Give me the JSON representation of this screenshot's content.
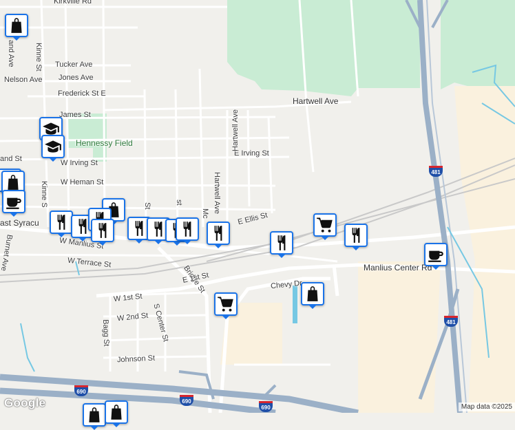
{
  "streets": {
    "kirkville_rd": "Kirkville Rd",
    "tucker_ave": "Tucker Ave",
    "jones_ave": "Jones Ave",
    "nelson_ave": "Nelson Ave",
    "frederick_st": "Frederick St E",
    "hartwell_ave_top": "Hartwell Ave",
    "james_st": "James St",
    "hartwell_ave_v1": "Hartwell Ave",
    "hartwell_ave_v2": "Hartwell Ave",
    "e_irving_st": "E Irving St",
    "w_irving_st": "W Irving St",
    "and_st": "and St",
    "w_heman_st": "W Heman St",
    "e_ellis_st": "E Ellis St",
    "kinne_st_top": "Kinne St",
    "kinne_st_mid": "Kinne S",
    "and_ave": "and Ave",
    "w_manlius_st": "W Manlius St",
    "w_terrace_st": "W Terrace St",
    "bridge_st": "Bridge St",
    "e_1st_st": "E 1st St",
    "manlius_center_rd": "Manlius Center Rd",
    "chevy_dr": "Chevy Dr",
    "w_1st_st": "W 1st St",
    "w_2nd_st": "W 2nd St",
    "s_center_st": "S Center St",
    "bagg_st": "Bagg St",
    "johnson_st": "Johnson St",
    "burnet_ave": "Burnet Ave",
    "east_syracuse": "ast Syracu",
    "st_label1": "St",
    "st_label2": "st",
    "mc_label": "Mc"
  },
  "places": {
    "hennessy_field": "Hennessy Field"
  },
  "shields": {
    "i481_a": "481",
    "i481_b": "481",
    "i690_a": "690",
    "i690_b": "690",
    "i690_c": "690"
  },
  "attribution": {
    "logo": "Google",
    "credit": "Map data ©2025"
  },
  "colors": {
    "background": "#f1f0ec",
    "park": "#c9ecd4",
    "industrial": "#faf1de",
    "highway": "#9bb0c7",
    "water": "#76c8e3",
    "pin_border": "#1a73e8"
  },
  "pins": [
    {
      "type": "shopping-bag-icon"
    },
    {
      "type": "school-icon"
    },
    {
      "type": "school-icon"
    },
    {
      "type": "shopping-bag-icon"
    },
    {
      "type": "shopping-bag-icon"
    },
    {
      "type": "coffee-icon"
    },
    {
      "type": "restaurant-icon"
    },
    {
      "type": "restaurant-icon"
    },
    {
      "type": "shopping-bag-icon"
    },
    {
      "type": "restaurant-icon"
    },
    {
      "type": "restaurant-icon"
    },
    {
      "type": "restaurant-icon"
    },
    {
      "type": "restaurant-icon"
    },
    {
      "type": "restaurant-icon"
    },
    {
      "type": "restaurant-icon"
    },
    {
      "type": "restaurant-icon"
    },
    {
      "type": "shopping-cart-icon"
    },
    {
      "type": "restaurant-icon"
    },
    {
      "type": "restaurant-icon"
    },
    {
      "type": "coffee-icon"
    },
    {
      "type": "shopping-cart-icon"
    },
    {
      "type": "shopping-bag-icon"
    },
    {
      "type": "shopping-bag-icon"
    },
    {
      "type": "shopping-bag-icon"
    }
  ]
}
